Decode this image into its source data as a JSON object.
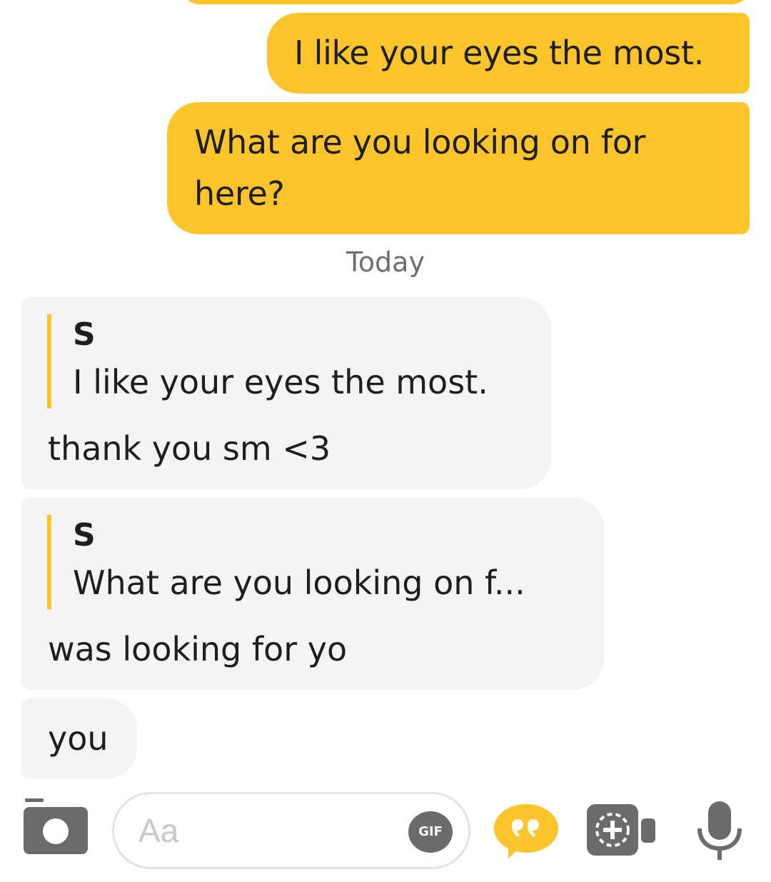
{
  "conversation": {
    "outgoing": [
      {
        "text": "I like your eyes the most."
      },
      {
        "text": "What are you looking on for here?"
      }
    ],
    "day_divider": "Today",
    "incoming": [
      {
        "quote_author": "S",
        "quote_text": "I like your eyes the most.",
        "text": "thank you sm <3"
      },
      {
        "quote_author": "S",
        "quote_text": "What are you looking on f...",
        "text": "was looking for yo"
      },
      {
        "text": "you"
      }
    ]
  },
  "composer": {
    "placeholder": "Aa",
    "gif_label": "GIF",
    "icons": [
      "camera-icon",
      "quote-icon",
      "video-call-icon",
      "microphone-icon"
    ]
  },
  "colors": {
    "outgoing_bubble": "#fdc52b",
    "incoming_bubble": "#f4f4f4",
    "icon_gray": "#6b6b6b",
    "accent": "#fdc52b"
  }
}
